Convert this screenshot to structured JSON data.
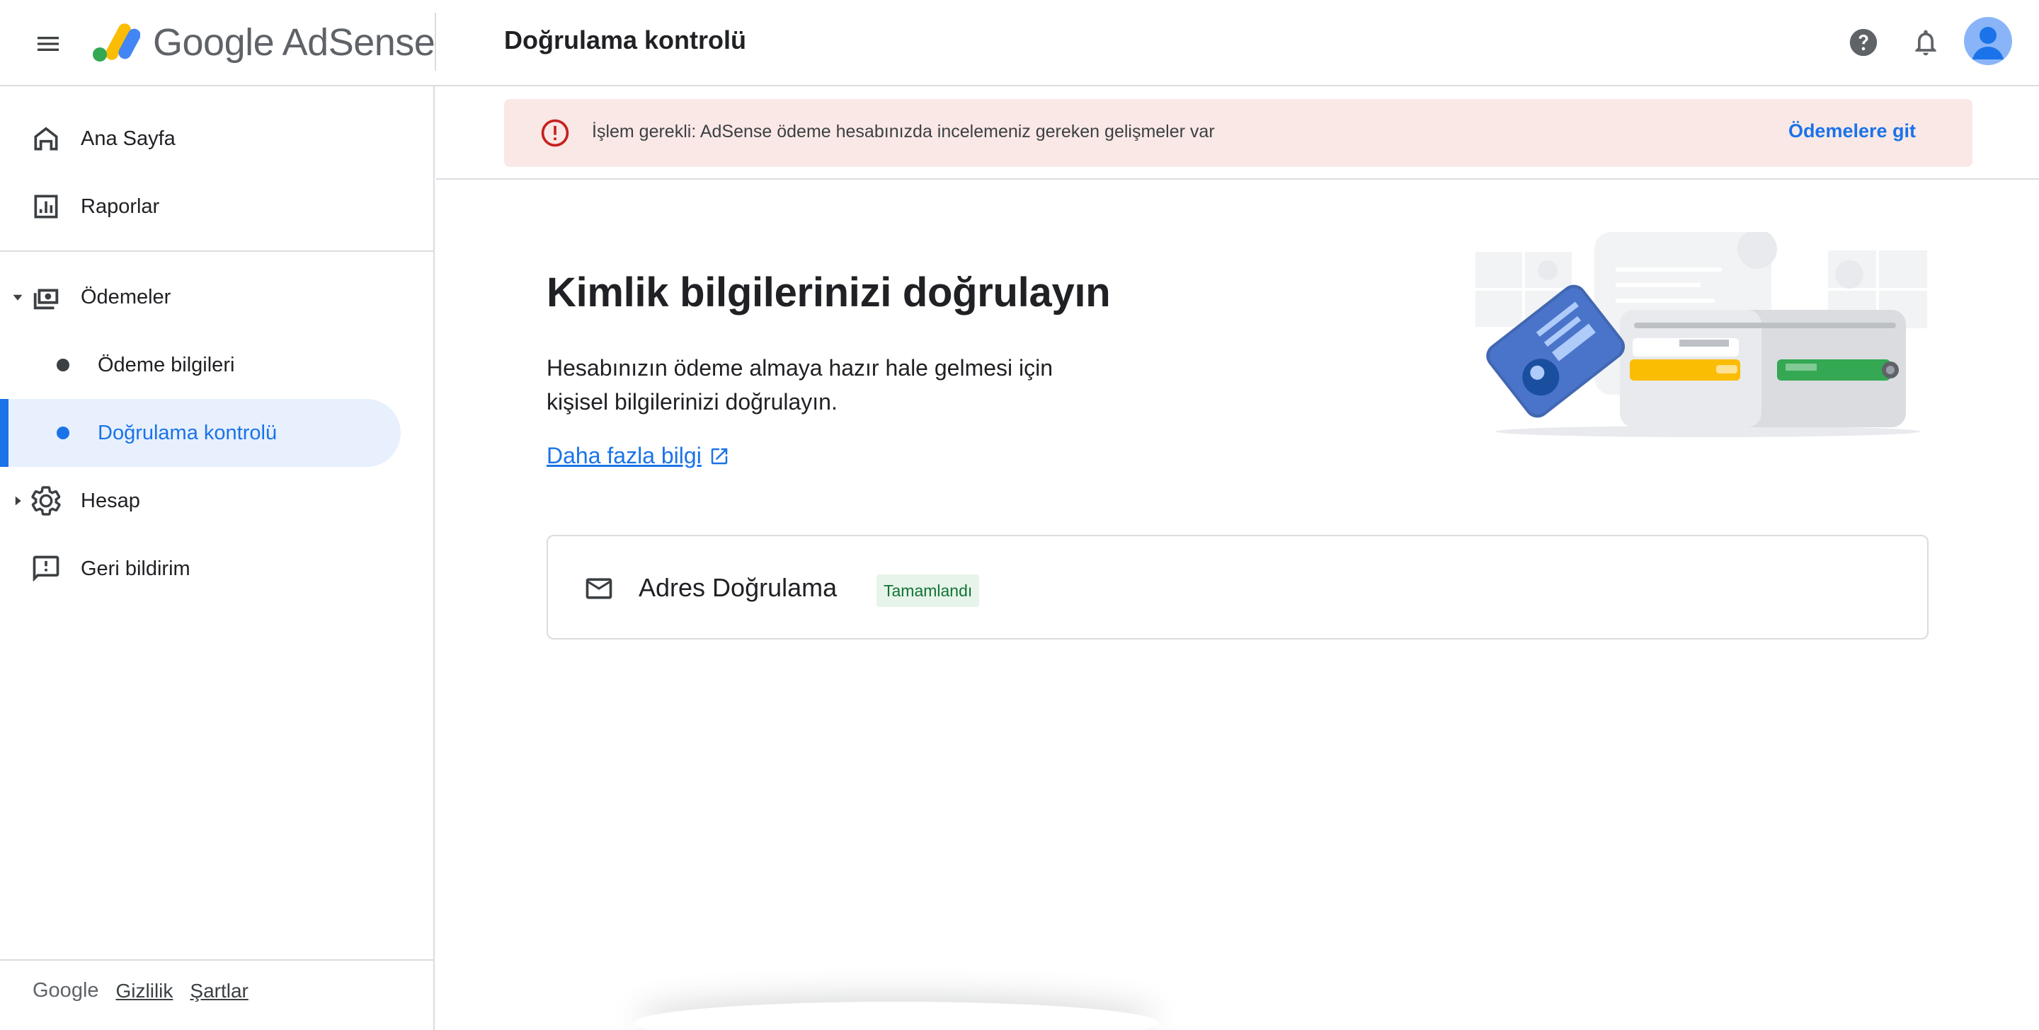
{
  "header": {
    "brand": "Google AdSense",
    "page_title": "Doğrulama kontrolü",
    "icons": [
      "menu-icon",
      "help-icon",
      "bell-icon",
      "avatar"
    ]
  },
  "sidebar": {
    "items": [
      {
        "label": "Ana Sayfa",
        "icon": "home-icon"
      },
      {
        "label": "Raporlar",
        "icon": "bar-chart-icon"
      },
      {
        "label": "Ödemeler",
        "icon": "payments-icon",
        "expanded": true
      },
      {
        "label": "Ödeme bilgileri"
      },
      {
        "label": "Doğrulama kontrolü",
        "active": true
      },
      {
        "label": "Hesap",
        "icon": "gear-icon",
        "expanded": false
      },
      {
        "label": "Geri bildirim",
        "icon": "feedback-icon"
      }
    ],
    "footer": {
      "brand": "Google",
      "privacy": "Gizlilik",
      "terms": "Şartlar"
    }
  },
  "alert": {
    "text": "İşlem gerekli: AdSense ödeme hesabınızda incelemeniz gereken gelişmeler var",
    "action": "Ödemelere git"
  },
  "main": {
    "heading": "Kimlik bilgilerinizi doğrulayın",
    "description": "Hesabınızın ödeme almaya hazır hale gelmesi için kişisel bilgilerinizi doğrulayın.",
    "learn_more": "Daha fazla bilgi",
    "card": {
      "title": "Adres Doğrulama",
      "status": "Tamamlandı"
    }
  },
  "colors": {
    "accent": "#1a73e8",
    "alert_bg": "#fae8e6",
    "alert_icon": "#c5221f",
    "success_bg": "#e6f4ea",
    "success_text": "#137333",
    "active_bg": "#e8f0fe"
  }
}
